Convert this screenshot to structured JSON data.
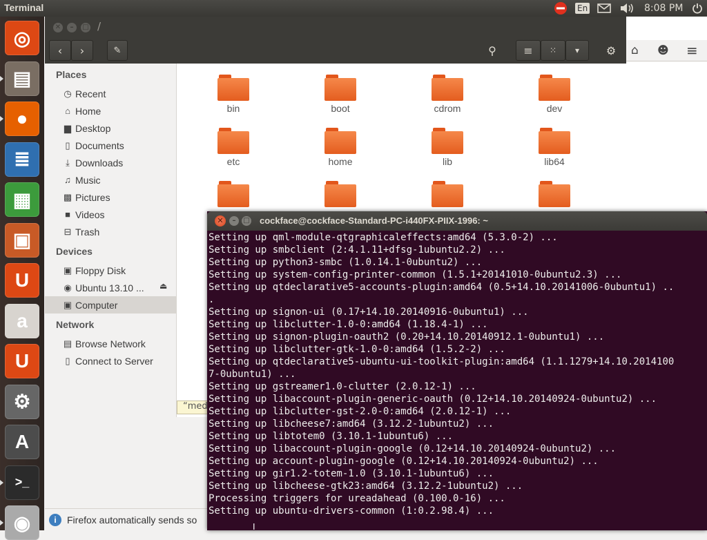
{
  "topbar": {
    "app_title": "Terminal",
    "language": "En",
    "clock": "8:08 PM",
    "icons": [
      "session-alert-icon",
      "mail-icon",
      "volume-icon",
      "power-icon"
    ]
  },
  "launcher": {
    "items": [
      {
        "name": "dash-home",
        "glyph": "◎",
        "color": "#dd4814"
      },
      {
        "name": "files",
        "glyph": "▤",
        "color": "#7a6e63"
      },
      {
        "name": "firefox",
        "glyph": "●",
        "color": "#e66000"
      },
      {
        "name": "libreoffice-writer",
        "glyph": "≣",
        "color": "#2f6fb0"
      },
      {
        "name": "libreoffice-calc",
        "glyph": "▦",
        "color": "#3c9b3c"
      },
      {
        "name": "libreoffice-impress",
        "glyph": "▣",
        "color": "#c85a26"
      },
      {
        "name": "ubuntu-software",
        "glyph": "U",
        "color": "#dd4814"
      },
      {
        "name": "amazon",
        "glyph": "a",
        "color": "#d8d4cf"
      },
      {
        "name": "ubuntu-one",
        "glyph": "U",
        "color": "#dd4814"
      },
      {
        "name": "system-settings",
        "glyph": "⚙",
        "color": "#666"
      },
      {
        "name": "software-updater",
        "glyph": "A",
        "color": "#4c4c4c"
      },
      {
        "name": "terminal",
        "glyph": ">_",
        "color": "#2b2b2b"
      },
      {
        "name": "dvd",
        "glyph": "◉",
        "color": "#aaa"
      }
    ]
  },
  "files": {
    "path": "/",
    "sidebar": {
      "places_header": "Places",
      "places": [
        {
          "label": "Recent",
          "icon": "◷"
        },
        {
          "label": "Home",
          "icon": "⌂"
        },
        {
          "label": "Desktop",
          "icon": "▆"
        },
        {
          "label": "Documents",
          "icon": "▯"
        },
        {
          "label": "Downloads",
          "icon": "⤓"
        },
        {
          "label": "Music",
          "icon": "♫"
        },
        {
          "label": "Pictures",
          "icon": "▩"
        },
        {
          "label": "Videos",
          "icon": "■"
        },
        {
          "label": "Trash",
          "icon": "⊟"
        }
      ],
      "devices_header": "Devices",
      "devices": [
        {
          "label": "Floppy Disk",
          "icon": "▣"
        },
        {
          "label": "Ubuntu 13.10 ...",
          "icon": "◉"
        },
        {
          "label": "Computer",
          "icon": "▣"
        }
      ],
      "network_header": "Network",
      "network": [
        {
          "label": "Browse Network",
          "icon": "▤"
        },
        {
          "label": "Connect to Server",
          "icon": "▯"
        }
      ]
    },
    "folders": [
      "bin",
      "boot",
      "cdrom",
      "dev",
      "etc",
      "home",
      "lib",
      "lib64",
      "",
      "",
      "",
      ""
    ],
    "status_text": "“med"
  },
  "notice": {
    "text": "Firefox automatically sends so"
  },
  "terminal": {
    "title": "cockface@cockface-Standard-PC-i440FX-PIIX-1996: ~",
    "lines": [
      "Setting up qml-module-qtgraphicaleffects:amd64 (5.3.0-2) ...",
      "Setting up smbclient (2:4.1.11+dfsg-1ubuntu2.2) ...",
      "Setting up python3-smbc (1.0.14.1-0ubuntu2) ...",
      "Setting up system-config-printer-common (1.5.1+20141010-0ubuntu2.3) ...",
      "Setting up qtdeclarative5-accounts-plugin:amd64 (0.5+14.10.20141006-0ubuntu1) ..",
      ".",
      "Setting up signon-ui (0.17+14.10.20140916-0ubuntu1) ...",
      "Setting up libclutter-1.0-0:amd64 (1.18.4-1) ...",
      "Setting up signon-plugin-oauth2 (0.20+14.10.20140912.1-0ubuntu1) ...",
      "Setting up libclutter-gtk-1.0-0:amd64 (1.5.2-2) ...",
      "Setting up qtdeclarative5-ubuntu-ui-toolkit-plugin:amd64 (1.1.1279+14.10.2014100",
      "7-0ubuntu1) ...",
      "Setting up gstreamer1.0-clutter (2.0.12-1) ...",
      "Setting up libaccount-plugin-generic-oauth (0.12+14.10.20140924-0ubuntu2) ...",
      "Setting up libclutter-gst-2.0-0:amd64 (2.0.12-1) ...",
      "Setting up libcheese7:amd64 (3.12.2-1ubuntu2) ...",
      "Setting up libtotem0 (3.10.1-1ubuntu6) ...",
      "Setting up libaccount-plugin-google (0.12+14.10.20140924-0ubuntu2) ...",
      "Setting up account-plugin-google (0.12+14.10.20140924-0ubuntu2) ...",
      "Setting up gir1.2-totem-1.0 (3.10.1-1ubuntu6) ...",
      "Setting up libcheese-gtk23:amd64 (3.12.2-1ubuntu2) ...",
      "Processing triggers for ureadahead (0.100.0-16) ...",
      "Setting up ubuntu-drivers-common (1:0.2.98.4) ..."
    ]
  }
}
